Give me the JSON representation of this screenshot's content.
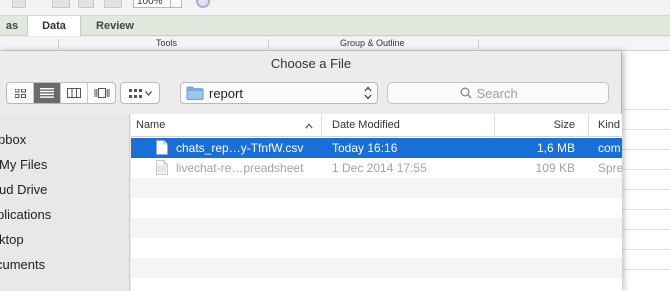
{
  "ribbon": {
    "tabs": [
      {
        "label": "as"
      },
      {
        "label": "Data"
      },
      {
        "label": "Review"
      }
    ],
    "zoom": "100%",
    "groups": [
      {
        "label": "Tools"
      },
      {
        "label": "Group & Outline"
      }
    ]
  },
  "dialog": {
    "title": "Choose a File",
    "view_buttons": [
      "icon-view-icon",
      "list-view-icon",
      "column-view-icon",
      "cover-flow-view-icon"
    ],
    "active_view": "list",
    "location": "report",
    "search_placeholder": "Search"
  },
  "sidebar": {
    "items": [
      {
        "label": "pbox"
      },
      {
        "label": "My Files"
      },
      {
        "label": "ud Drive"
      },
      {
        "label": "plications"
      },
      {
        "label": "ktop"
      },
      {
        "label": "cuments"
      }
    ]
  },
  "filelist": {
    "columns": {
      "name": "Name",
      "date": "Date Modified",
      "size": "Size",
      "kind": "Kind"
    },
    "sort_column": "Name",
    "sort_direction": "ascending",
    "rows": [
      {
        "name": "chats_rep…y-TfnfW.csv",
        "date": "Today 16:16",
        "size": "1,6 MB",
        "kind": "com",
        "state": "selected"
      },
      {
        "name": "livechat-re…preadsheet",
        "date": "1 Dec 2014 17:55",
        "size": "109 KB",
        "kind": "Spre",
        "state": "disabled"
      }
    ]
  },
  "colors": {
    "selection": "#1a6fd6",
    "ribbon_tabs": "#dfeadd"
  }
}
